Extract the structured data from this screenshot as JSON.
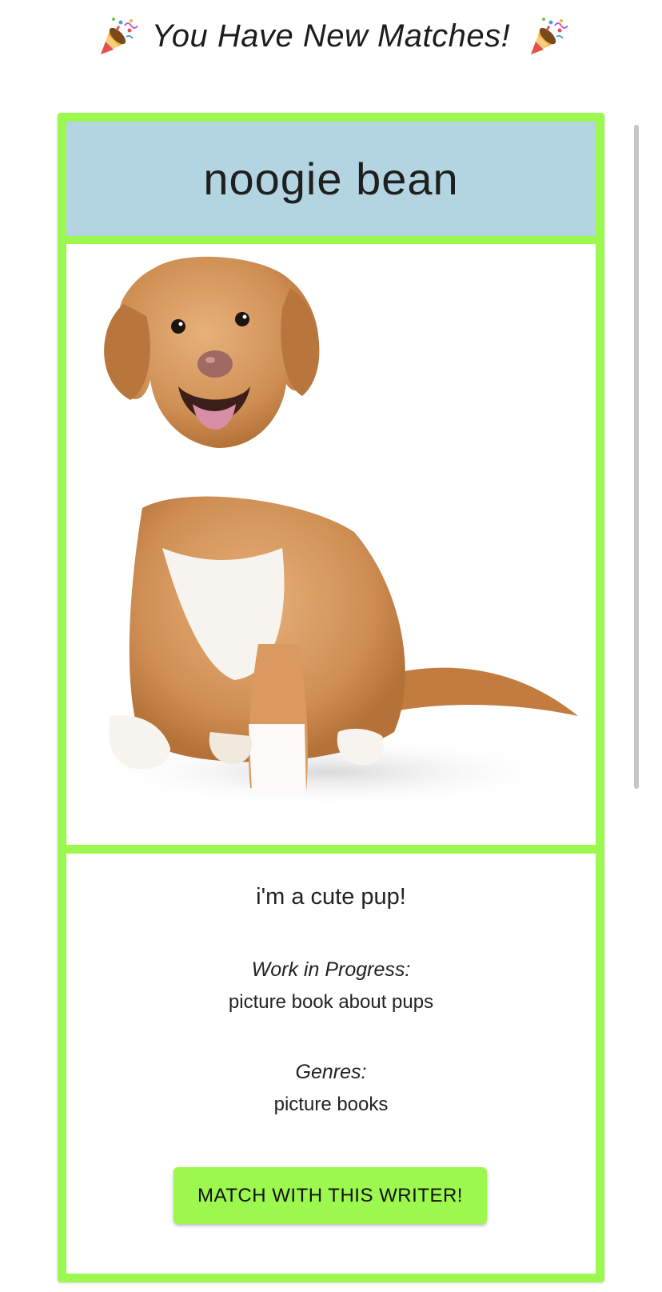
{
  "header": {
    "title": "You Have New Matches!",
    "left_icon": "party-popper-icon",
    "right_icon": "party-popper-icon"
  },
  "match_card": {
    "name": "noogie bean",
    "photo": "dog-photo",
    "bio": "i'm a cute pup!",
    "work_in_progress_label": "Work in Progress:",
    "work_in_progress": "picture book about pups",
    "genres_label": "Genres:",
    "genres": "picture books",
    "match_button_label": "MATCH WITH THIS WRITER!"
  },
  "colors": {
    "card_border": "#9cf74e",
    "name_panel_background": "#b3d5e1",
    "button_background": "#9cf74e"
  }
}
